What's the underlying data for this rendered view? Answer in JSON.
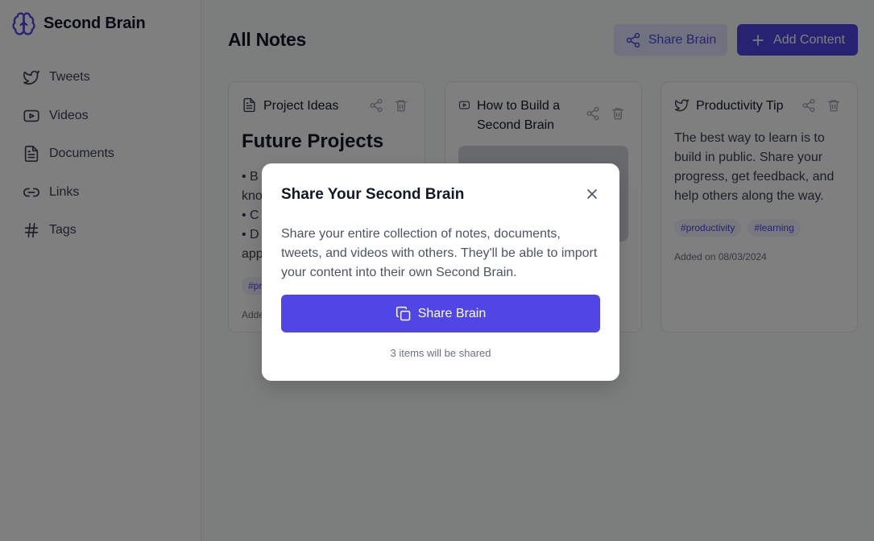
{
  "app": {
    "title": "Second Brain"
  },
  "sidebar": {
    "items": [
      {
        "label": "Tweets",
        "icon": "twitter-icon"
      },
      {
        "label": "Videos",
        "icon": "youtube-icon"
      },
      {
        "label": "Documents",
        "icon": "document-icon"
      },
      {
        "label": "Links",
        "icon": "link-icon"
      },
      {
        "label": "Tags",
        "icon": "hash-icon"
      }
    ]
  },
  "header": {
    "title": "All Notes",
    "share_label": "Share Brain",
    "add_label": "Add Content"
  },
  "cards": [
    {
      "type": "document",
      "title": "Project Ideas",
      "heading": "Future Projects",
      "list_lines": [
        "•  B",
        "kno",
        "•  C",
        "•  D",
        "app"
      ],
      "tag": "#pr",
      "added": "Adde"
    },
    {
      "type": "youtube",
      "title": "How to Build a Second Brain"
    },
    {
      "type": "twitter",
      "title": "Productivity Tip",
      "text": "The best way to learn is to build in public. Share your progress, get feedback, and help others along the way.",
      "tags": [
        "#productivity",
        "#learning"
      ],
      "added": "Added on 08/03/2024"
    }
  ],
  "modal": {
    "title": "Share Your Second Brain",
    "description": "Share your entire collection of notes, documents, tweets, and videos with others. They'll be able to import your content into their own Second Brain.",
    "button_label": "Share Brain",
    "footer": "3 items will be shared"
  },
  "colors": {
    "accent": "#4f46e5",
    "accent_light": "#e0e7ff",
    "overlay": "rgba(0,0,0,0.5)"
  }
}
